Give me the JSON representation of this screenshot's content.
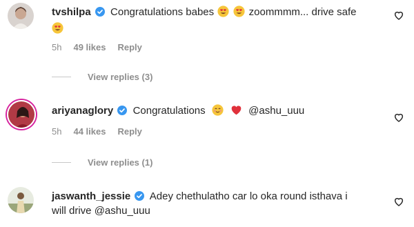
{
  "comments": [
    {
      "username": "tvshilpa",
      "text_before": "Congratulations babes",
      "text_after": "zoommmm... drive safe",
      "time": "5h",
      "likes": "49 likes",
      "reply": "Reply",
      "view_replies": "View replies (3)"
    },
    {
      "username": "ariyanaglory",
      "text_before": "Congratulations",
      "mention": "@ashu_uuu",
      "time": "5h",
      "likes": "44 likes",
      "reply": "Reply",
      "view_replies": "View replies (1)"
    },
    {
      "username": "jaswanth_jessie",
      "text_line1": "Adey chethulatho car lo oka round isthava i",
      "text_line2": "will drive",
      "mention": "@ashu_uuu"
    }
  ],
  "colors": {
    "verified": "#3897f0",
    "muted": "#8e8e8e",
    "text": "#262626"
  },
  "icons": [
    "verified-badge-icon",
    "heart-outline-icon",
    "heart-eyes-emoji",
    "smiling-face-emoji",
    "red-heart-emoji"
  ]
}
